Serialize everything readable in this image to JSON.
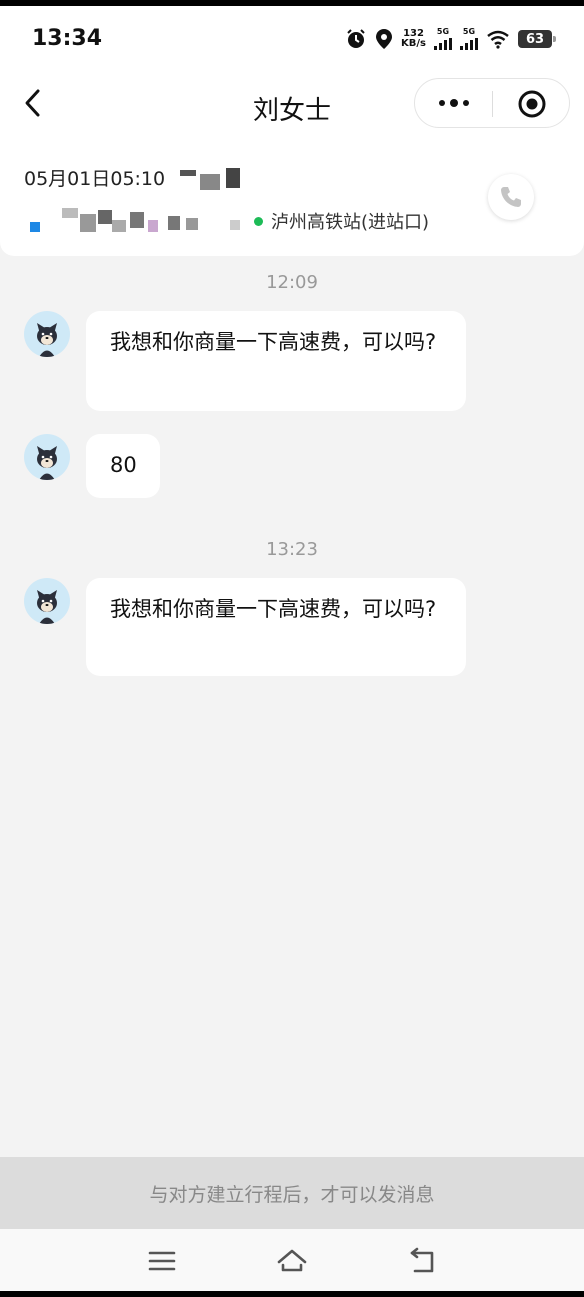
{
  "status_bar": {
    "time": "13:34",
    "net_speed_value": "132",
    "net_speed_unit": "KB/s",
    "sim1_label": "5G",
    "sim2_label": "5G",
    "battery": "63"
  },
  "header": {
    "title": "刘女士",
    "icons": [
      "back-icon",
      "more-icon",
      "target-icon"
    ]
  },
  "trip": {
    "date_time": "05月01日05:10",
    "location": "泸州高铁站(进站口)"
  },
  "messages": [
    {
      "time": "12:09",
      "text": "我想和你商量一下高速费，可以吗?"
    },
    {
      "text": "80"
    },
    {
      "time": "13:23",
      "text": "我想和你商量一下高速费，可以吗?"
    }
  ],
  "footer": {
    "notice": "与对方建立行程后，才可以发消息"
  },
  "colors": {
    "location_dot": "#1dbb57",
    "avatar_bg": "#cfe9f7",
    "chat_bg": "#f3f3f3"
  }
}
